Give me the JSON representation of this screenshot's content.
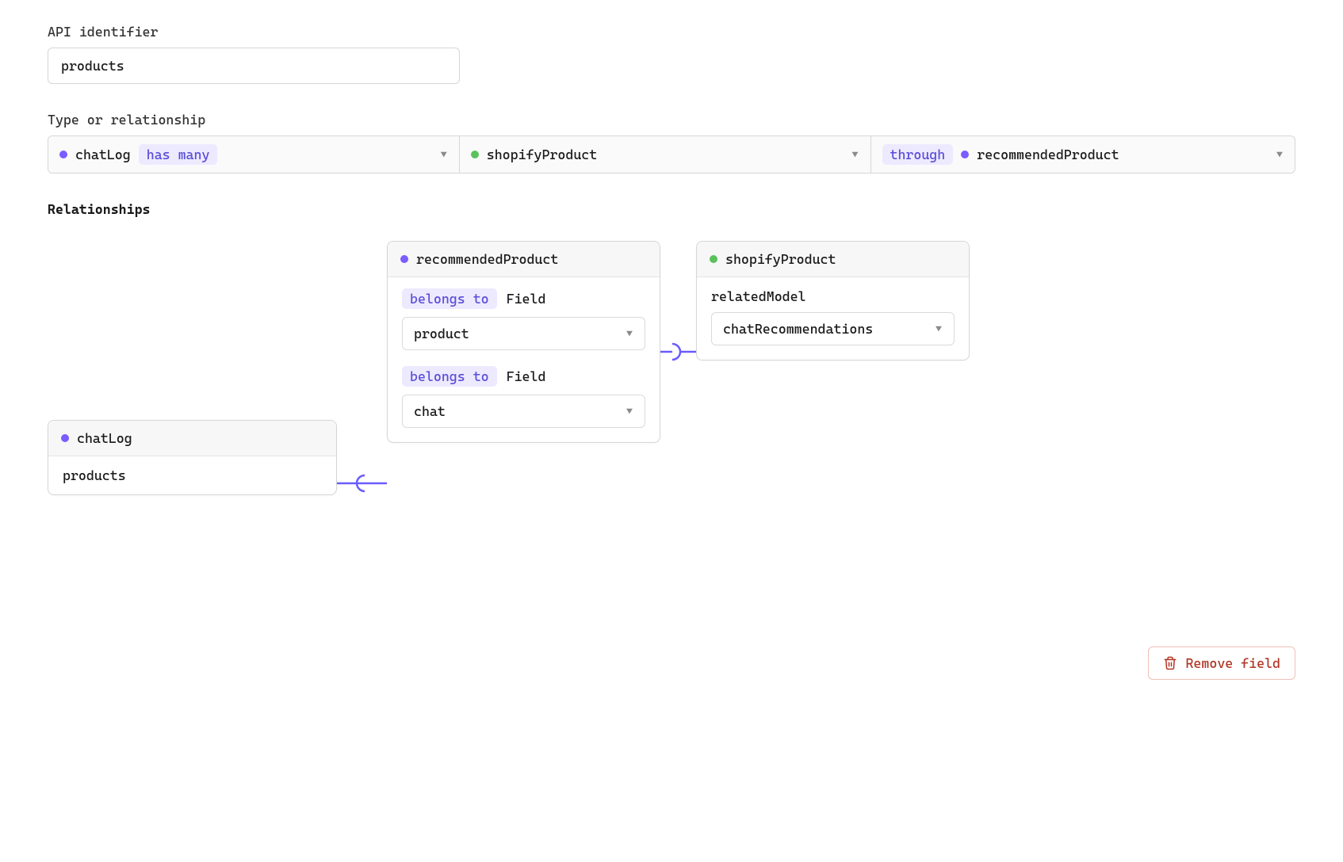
{
  "api_identifier": {
    "label": "API identifier",
    "value": "products"
  },
  "type_relationship": {
    "label": "Type or relationship",
    "left": {
      "model": "chatLog",
      "relation_badge": "has many"
    },
    "middle": {
      "model": "shopifyProduct"
    },
    "right": {
      "through_badge": "through",
      "model": "recommendedProduct"
    }
  },
  "relationships": {
    "heading": "Relationships",
    "chatlog_card": {
      "title": "chatLog",
      "field_row": "products"
    },
    "recommended_card": {
      "title": "recommendedProduct",
      "block1": {
        "badge": "belongs to",
        "label": "Field",
        "select_value": "product"
      },
      "block2": {
        "badge": "belongs to",
        "label": "Field",
        "select_value": "chat"
      }
    },
    "shopify_card": {
      "title": "shopifyProduct",
      "label": "relatedModel",
      "select_value": "chatRecommendations"
    }
  },
  "remove_button": "Remove field",
  "colors": {
    "purple": "#7a5cff",
    "green": "#5bc25b",
    "badge_bg": "#edeaff",
    "remove": "#b13625",
    "connector": "#6a5cff"
  }
}
